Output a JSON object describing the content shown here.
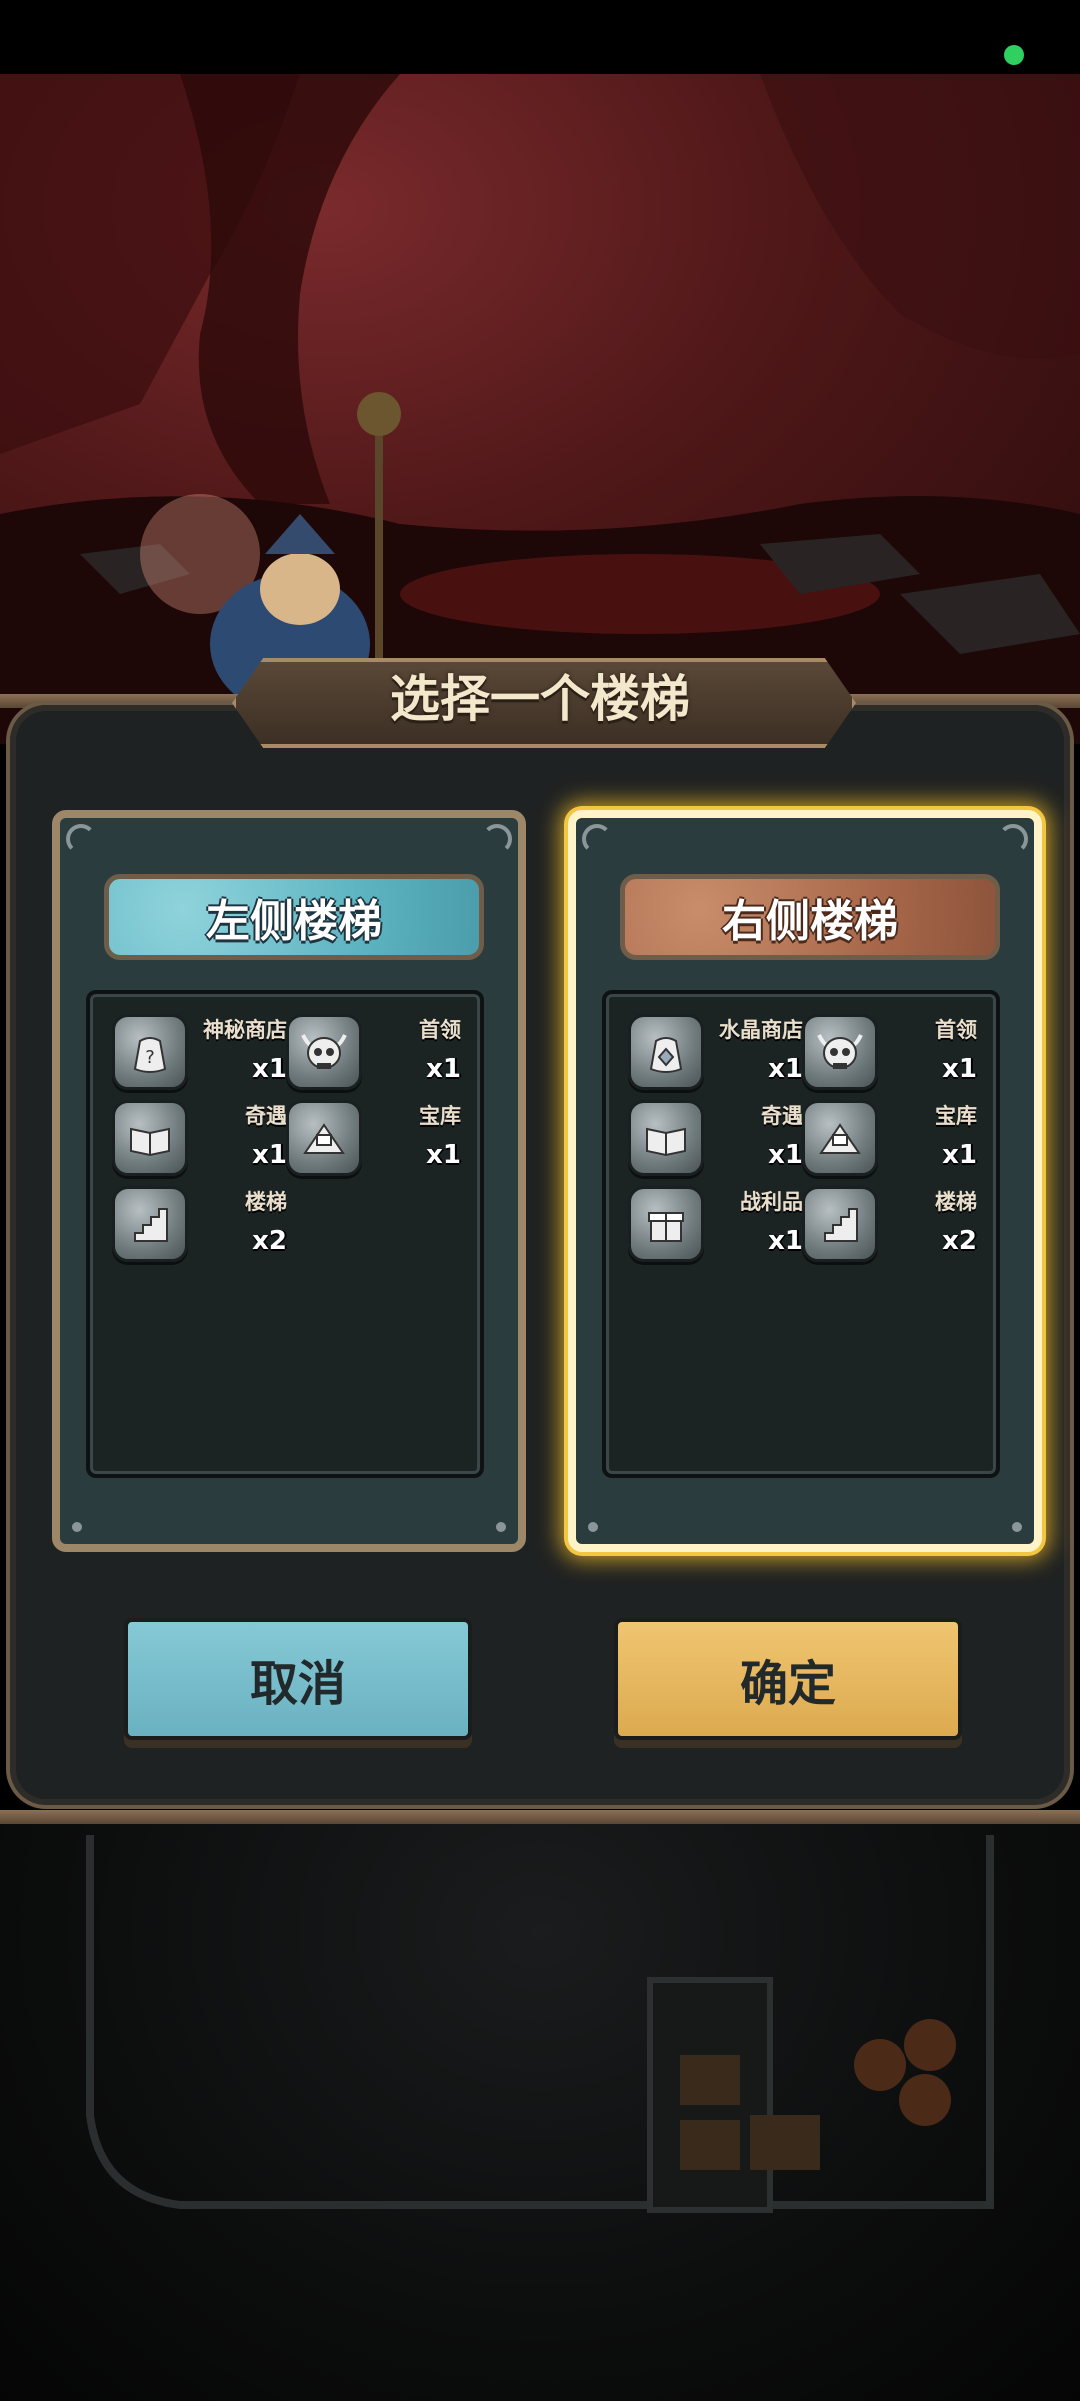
{
  "dialog": {
    "title": "选择一个楼梯",
    "left": {
      "title": "左侧楼梯",
      "items": [
        {
          "icon": "mystery-bag-icon",
          "label": "神秘商店",
          "count": "x1"
        },
        {
          "icon": "boss-skull-icon",
          "label": "首领",
          "count": "x1"
        },
        {
          "icon": "book-icon",
          "label": "奇遇",
          "count": "x1"
        },
        {
          "icon": "treasure-pile-icon",
          "label": "宝库",
          "count": "x1"
        },
        {
          "icon": "stairs-icon",
          "label": "楼梯",
          "count": "x2"
        }
      ]
    },
    "right": {
      "title": "右侧楼梯",
      "selected": true,
      "items": [
        {
          "icon": "crystal-bag-icon",
          "label": "水晶商店",
          "count": "x1"
        },
        {
          "icon": "boss-skull-icon",
          "label": "首领",
          "count": "x1"
        },
        {
          "icon": "book-icon",
          "label": "奇遇",
          "count": "x1"
        },
        {
          "icon": "treasure-pile-icon",
          "label": "宝库",
          "count": "x1"
        },
        {
          "icon": "gift-box-icon",
          "label": "战利品",
          "count": "x1"
        },
        {
          "icon": "stairs-icon",
          "label": "楼梯",
          "count": "x2"
        }
      ]
    },
    "cancel_label": "取消",
    "confirm_label": "确定"
  },
  "colors": {
    "accent_blue": "#6ab1c1",
    "accent_gold": "#dcaa4f",
    "selected_glow": "#f2c640"
  }
}
